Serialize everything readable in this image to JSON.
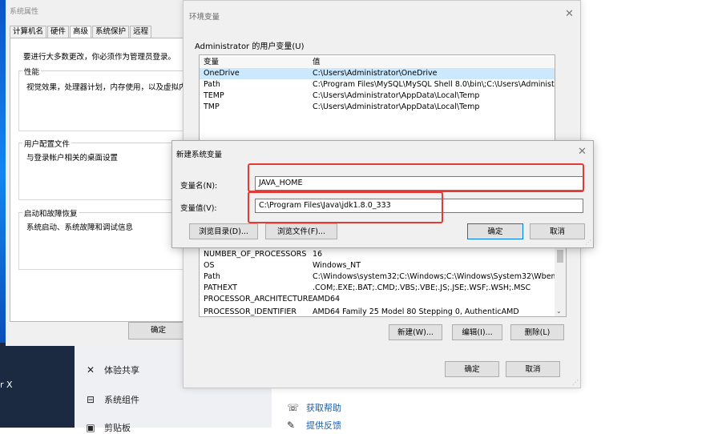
{
  "system_properties": {
    "title": "系统属性",
    "tabs": [
      "计算机名",
      "硬件",
      "高级",
      "系统保护",
      "远程"
    ],
    "note": "要进行大多数更改，你必须作为管理员登录。",
    "performance": {
      "legend": "性能",
      "desc": "视觉效果，处理器计划，内存使用，以及虚拟内"
    },
    "user_profiles": {
      "legend": "用户配置文件",
      "desc": "与登录帐户相关的桌面设置"
    },
    "startup_recovery": {
      "legend": "启动和故障恢复",
      "desc": "系统启动、系统故障和调试信息"
    },
    "ok_label": "确定"
  },
  "env_vars": {
    "title": "环境变量",
    "user_section_label": "Administrator 的用户变量(U)",
    "columns": [
      "变量",
      "值"
    ],
    "user_vars": [
      {
        "name": "OneDrive",
        "value": "C:\\Users\\Administrator\\OneDrive"
      },
      {
        "name": "Path",
        "value": "C:\\Program Files\\MySQL\\MySQL Shell 8.0\\bin\\;C:\\Users\\Administr..."
      },
      {
        "name": "TEMP",
        "value": "C:\\Users\\Administrator\\AppData\\Local\\Temp"
      },
      {
        "name": "TMP",
        "value": "C:\\Users\\Administrator\\AppData\\Local\\Temp"
      }
    ],
    "system_vars": [
      {
        "name": "NUMBER_OF_PROCESSORS",
        "value": "16"
      },
      {
        "name": "OS",
        "value": "Windows_NT"
      },
      {
        "name": "Path",
        "value": "C:\\Windows\\system32;C:\\Windows;C:\\Windows\\System32\\Wbem;..."
      },
      {
        "name": "PATHEXT",
        "value": ".COM;.EXE;.BAT;.CMD;.VBS;.VBE;.JS;.JSE;.WSF;.WSH;.MSC"
      },
      {
        "name": "PROCESSOR_ARCHITECTURE",
        "value": "AMD64"
      },
      {
        "name": "PROCESSOR_IDENTIFIER",
        "value": "AMD64 Family 25 Model 80 Stepping 0, AuthenticAMD"
      }
    ],
    "new_label": "新建(W)...",
    "edit_label": "编辑(I)...",
    "delete_label": "删除(L)",
    "ok_label": "确定",
    "cancel_label": "取消"
  },
  "new_var": {
    "title": "新建系统变量",
    "name_label": "变量名(N):",
    "name_value": "JAVA_HOME",
    "value_label": "变量值(V):",
    "value_value": "C:\\Program Files\\Java\\jdk1.8.0_333",
    "browse_dir_label": "浏览目录(D)...",
    "browse_file_label": "浏览文件(F)...",
    "ok_label": "确定",
    "cancel_label": "取消",
    "highlight_color": "#e53935"
  },
  "settings_bg": {
    "items": [
      {
        "icon": "share-icon",
        "label": "体验共享"
      },
      {
        "icon": "components-icon",
        "label": "系统组件"
      },
      {
        "icon": "clipboard-icon",
        "label": "剪贴板"
      }
    ],
    "links": [
      {
        "icon": "help-icon",
        "label": "获取帮助"
      },
      {
        "icon": "feedback-icon",
        "label": "提供反馈"
      }
    ],
    "left_glyph": "r X"
  }
}
